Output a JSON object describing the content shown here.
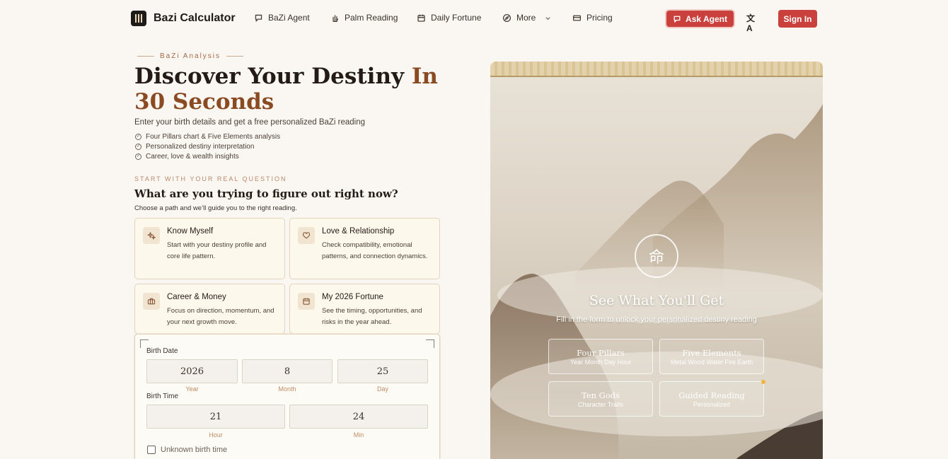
{
  "nav": {
    "brand": "Bazi Calculator",
    "items": [
      {
        "label": "BaZi Agent",
        "icon": "chat-bubble-icon"
      },
      {
        "label": "Palm Reading",
        "icon": "hand-icon"
      },
      {
        "label": "Daily Fortune",
        "icon": "calendar-icon"
      },
      {
        "label": "More",
        "icon": "compass-icon"
      },
      {
        "label": "Pricing",
        "icon": "card-icon"
      }
    ],
    "ask_agent": "Ask Agent",
    "sign_in": "Sign In"
  },
  "hero": {
    "eyebrow": "BaZi Analysis",
    "title_main": "Discover Your Destiny",
    "title_accent": "In 30 Seconds",
    "subtitle": "Enter your birth details and get a free personalized BaZi reading",
    "bullets": [
      "Four Pillars chart & Five Elements analysis",
      "Personalized destiny interpretation",
      "Career, love & wealth insights"
    ]
  },
  "question": {
    "eyebrow": "START WITH YOUR REAL QUESTION",
    "title": "What are you trying to figure out right now?",
    "subtitle": "Choose a path and we’ll guide you to the right reading."
  },
  "cards": [
    {
      "title": "Know Myself",
      "desc": "Start with your destiny profile and core life pattern."
    },
    {
      "title": "Love & Relationship",
      "desc": "Check compatibility, emotional patterns, and connection dynamics."
    },
    {
      "title": "Career & Money",
      "desc": "Focus on direction, momentum, and your next growth move."
    },
    {
      "title": "My 2026 Fortune",
      "desc": "See the timing, opportunities, and risks in the year ahead."
    }
  ],
  "form": {
    "birth_date_label": "Birth Date",
    "year": "2026",
    "month": "8",
    "day": "25",
    "year_cap": "Year",
    "month_cap": "Month",
    "day_cap": "Day",
    "birth_time_label": "Birth Time",
    "hour": "21",
    "min": "24",
    "hour_cap": "Hour",
    "min_cap": "Min",
    "unknown_time": "Unknown birth time"
  },
  "panel": {
    "seal_char": "命",
    "title": "See What You'll Get",
    "subtitle": "Fill in the form to unlock your personalized destiny reading",
    "features": [
      {
        "title": "Four Pillars",
        "sub": "Year Month Day Hour"
      },
      {
        "title": "Five Elements",
        "sub": "Metal Wood Water Fire Earth"
      },
      {
        "title": "Ten Gods",
        "sub": "Character Traits"
      },
      {
        "title": "Guided Reading",
        "sub": "Personalized"
      }
    ]
  },
  "colors": {
    "accent": "#c9403c",
    "brown": "#8a4b22",
    "background": "#faf7f2"
  }
}
